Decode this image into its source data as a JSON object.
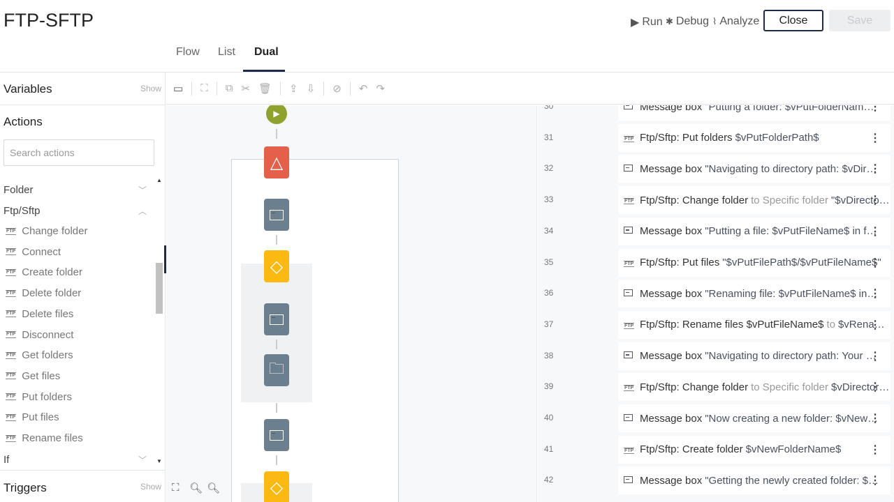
{
  "header": {
    "title": "FTP-SFTP",
    "run": "Run",
    "debug": "Debug",
    "analyze": "Analyze",
    "close": "Close",
    "save": "Save"
  },
  "tabs": [
    {
      "label": "Flow"
    },
    {
      "label": "List"
    },
    {
      "label": "Dual"
    }
  ],
  "sidebar": {
    "variables": "Variables",
    "variables_show": "Show",
    "actions": "Actions",
    "search_placeholder": "Search actions",
    "categories": {
      "folder": "Folder",
      "ftp": "Ftp/Sftp",
      "if": "If"
    },
    "ftp_items": [
      "Change folder",
      "Connect",
      "Create folder",
      "Delete folder",
      "Delete files",
      "Disconnect",
      "Get folders",
      "Get files",
      "Put folders",
      "Put files",
      "Rename files"
    ],
    "ftp_icon": "FTP",
    "triggers": "Triggers",
    "triggers_show": "Show"
  },
  "list": [
    {
      "num": "30",
      "icon": "message-box",
      "label": "Message box",
      "mid": "",
      "val": "\"Putting a folder: $vPutFolderName$ int..."
    },
    {
      "num": "31",
      "icon": "ftp",
      "label": "Ftp/Sftp: Put folders",
      "mid": "",
      "val": "$vPutFolderPath$"
    },
    {
      "num": "32",
      "icon": "message-box",
      "label": "Message box",
      "mid": "",
      "val": "\"Navigating to directory path: $vDirecto..."
    },
    {
      "num": "33",
      "icon": "ftp",
      "label": "Ftp/Sftp: Change folder",
      "mid": "to Specific folder",
      "val": "\"$vDirectory..."
    },
    {
      "num": "34",
      "icon": "message-box",
      "label": "Message box",
      "mid": "",
      "val": "\"Putting a file: $vPutFileName$ in folder:..."
    },
    {
      "num": "35",
      "icon": "ftp",
      "label": "Ftp/Sftp: Put files",
      "mid": "",
      "val": "\"$vPutFilePath$/$vPutFileName$\""
    },
    {
      "num": "36",
      "icon": "message-box",
      "label": "Message box",
      "mid": "",
      "val": "\"Renaming file: $vPutFileName$ in folde..."
    },
    {
      "num": "37",
      "icon": "ftp",
      "label": "Ftp/Sftp: Rename files $vPutFileName$",
      "mid": "to",
      "val": "$vRenameF..."
    },
    {
      "num": "38",
      "icon": "message-box",
      "label": "Message box",
      "mid": "",
      "val": "\"Navigating to directory path: Your Dire..."
    },
    {
      "num": "39",
      "icon": "ftp",
      "label": "Ftp/Sftp: Change folder",
      "mid": "to Specific folder",
      "val": "$vDirectory..."
    },
    {
      "num": "40",
      "icon": "message-box",
      "label": "Message box",
      "mid": "",
      "val": "\"Now creating a new folder: $vNewFold..."
    },
    {
      "num": "41",
      "icon": "ftp",
      "label": "Ftp/Sftp: Create folder",
      "mid": "",
      "val": "$vNewFolderName$"
    },
    {
      "num": "42",
      "icon": "message-box",
      "label": "Message box",
      "mid": "",
      "val": "\"Getting the newly created folder: $vNe..."
    }
  ]
}
